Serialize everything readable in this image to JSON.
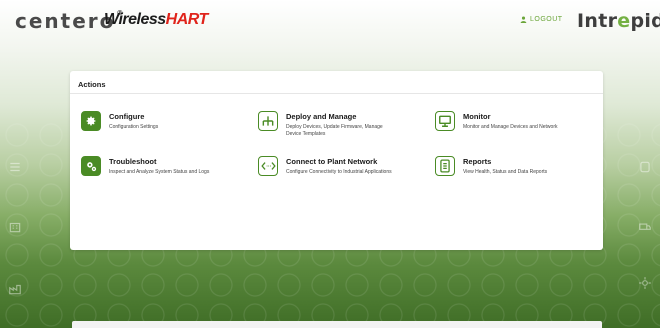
{
  "header": {
    "centero_logo": "centero",
    "whart_logo_prefix": "Wireless",
    "whart_logo_suffix": "HART",
    "logout_label": "LOGOUT",
    "intrepid_logo_a": "Intr",
    "intrepid_logo_e": "e",
    "intrepid_logo_b": "pid"
  },
  "actions_panel": {
    "title": "Actions",
    "items": [
      {
        "title": "Configure",
        "desc": "Configuration Settings",
        "icon": "gear-icon"
      },
      {
        "title": "Deploy and Manage",
        "desc": "Deploy Devices, Update Firmware, Manage Device Templates",
        "icon": "network-tree-icon"
      },
      {
        "title": "Monitor",
        "desc": "Monitor and Manage Devices and Network",
        "icon": "monitor-icon"
      },
      {
        "title": "Troubleshoot",
        "desc": "Inspect and Analyze System Status and Logs",
        "icon": "gears-wrench-icon"
      },
      {
        "title": "Connect to Plant Network",
        "desc": "Configure Connectivity to Industrial Applications",
        "icon": "code-arrows-icon"
      },
      {
        "title": "Reports",
        "desc": "View Health, Status and Data Reports",
        "icon": "report-icon"
      }
    ]
  },
  "colors": {
    "accent": "#4a8b25",
    "logout": "#6aa538",
    "hart_red": "#e0241b"
  }
}
